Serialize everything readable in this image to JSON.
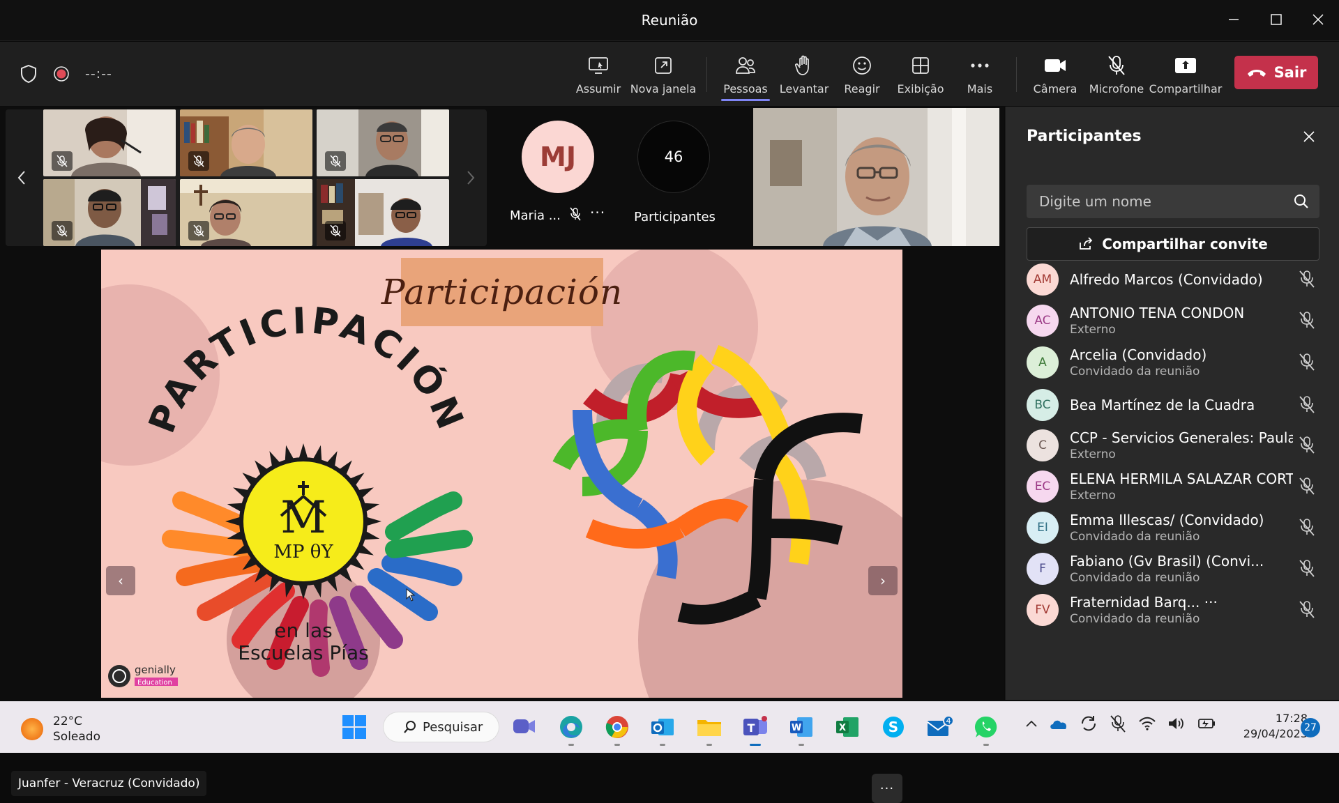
{
  "window": {
    "title": "Reunião"
  },
  "toolbar": {
    "timer": "--:--",
    "buttons": {
      "assumir": "Assumir",
      "nova_janela": "Nova janela",
      "pessoas": "Pessoas",
      "levantar": "Levantar",
      "reagir": "Reagir",
      "exibicao": "Exibição",
      "mais": "Mais",
      "camera": "Câmera",
      "microfone": "Microfone",
      "compartilhar": "Compartilhar"
    },
    "leave_label": "Sair",
    "colors": {
      "accent": "#7f85f5",
      "leave": "#c4314b",
      "record": "#e04b57"
    }
  },
  "stage": {
    "maria_tile": {
      "initials": "MJ",
      "name": "Maria ..."
    },
    "count_tile": {
      "count": "46",
      "label": "Participantes"
    },
    "slide": {
      "title": "Participación",
      "logo_arc_text": "PARTICIPACIÓN",
      "logo_monogram": "MP θΥ",
      "logo_subtitle_1": "en las",
      "logo_subtitle_2": "Escuelas Pías",
      "watermark": "genially",
      "watermark_sub": "Education"
    },
    "presenter_label": "Juanfer - Veracruz (Convidado)"
  },
  "panel": {
    "title": "Participantes",
    "search_placeholder": "Digite um nome",
    "invite_label": "Compartilhar convite",
    "participants": [
      {
        "initials": "AM",
        "name": "Alfredo Marcos (Convidado)",
        "sub": "",
        "bg": "#fbd9d4",
        "fg": "#a23a34"
      },
      {
        "initials": "AC",
        "name": "ANTONIO TENA CONDON",
        "sub": "Externo",
        "bg": "#f6d8ef",
        "fg": "#9b3a86"
      },
      {
        "initials": "A",
        "name": "Arcelia (Convidado)",
        "sub": "Convidado da reunião",
        "bg": "#dcefd8",
        "fg": "#3f7b3a"
      },
      {
        "initials": "BC",
        "name": "Bea Martínez de la Cuadra",
        "sub": "",
        "bg": "#d6ede6",
        "fg": "#2f6f5f"
      },
      {
        "initials": "C",
        "name": "CCP - Servicios Generales: Paula ...",
        "sub": "Externo",
        "bg": "#ece2df",
        "fg": "#6d5a55"
      },
      {
        "initials": "EC",
        "name": "ELENA HERMILA SALAZAR CORT...",
        "sub": "Externo",
        "bg": "#f6d8ef",
        "fg": "#9b3a86"
      },
      {
        "initials": "EI",
        "name": "Emma Illescas/ (Convidado)",
        "sub": "Convidado da reunião",
        "bg": "#d8eef4",
        "fg": "#2f6f84"
      },
      {
        "initials": "F",
        "name": "Fabiano (Gv Brasil) (Convi...",
        "sub": "Convidado da reunião",
        "bg": "#e2e2f6",
        "fg": "#4b4b8c"
      },
      {
        "initials": "FV",
        "name": "Fraternidad Barq... ···",
        "sub": "Convidado da reunião",
        "bg": "#fbd9d4",
        "fg": "#a23a34"
      }
    ]
  },
  "taskbar": {
    "weather_temp": "22°C",
    "weather_desc": "Soleado",
    "search_label": "Pesquisar",
    "mail_badge": "4",
    "time": "17:28",
    "date": "29/04/2023",
    "notification_count": "27"
  }
}
